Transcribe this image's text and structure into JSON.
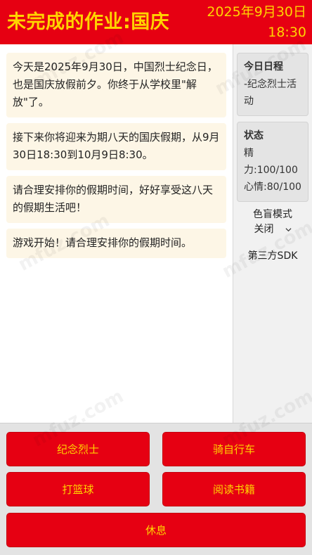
{
  "header": {
    "title": "未完成的作业:国庆",
    "date": "2025年9月30日",
    "time": "18:30"
  },
  "messages": [
    "今天是2025年9月30日，中国烈士纪念日，也是国庆放假前夕。你终于从学校里\"解放\"了。",
    "接下来你将迎来为期八天的国庆假期，从9月30日18:30到10月9日8:30。",
    "请合理安排你的假期时间，好好享受这八天的假期生活吧！",
    "游戏开始！请合理安排你的假期时间。"
  ],
  "sidebar": {
    "schedule": {
      "title": "今日日程",
      "item": "-纪念烈士活动"
    },
    "status": {
      "title": "状态",
      "energy": "精力:100/100",
      "mood": "心情:80/100"
    },
    "colorblind": {
      "label": "色盲模式",
      "value": "关闭"
    },
    "sdk_label": "第三方SDK"
  },
  "actions": {
    "martyrs": "纪念烈士",
    "cycling": "骑自行车",
    "basketball": "打篮球",
    "reading": "阅读书籍",
    "rest": "休息"
  },
  "watermark": "mfuz.com",
  "colors": {
    "primary_red": "#e60012",
    "accent_yellow": "#ffd400",
    "message_bg": "#fdf6e6"
  }
}
